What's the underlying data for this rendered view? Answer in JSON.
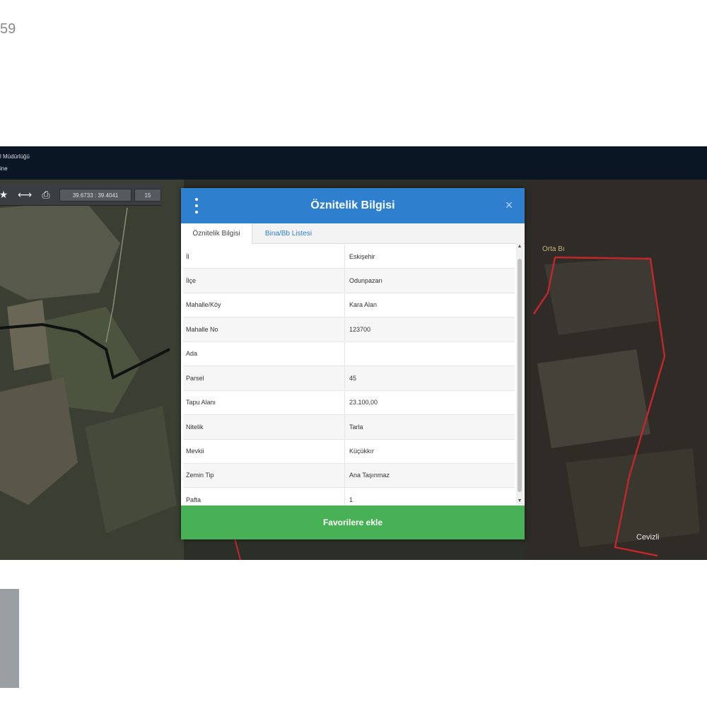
{
  "corner_text": "59",
  "header": {
    "org_text": "l Müdürlüğü",
    "sub_text": "ine"
  },
  "toolbar": {
    "star_icon": "star-icon",
    "measure_icon": "ruler-icon",
    "print_icon": "print-icon",
    "coordinates": "39.6733 : 39.4041",
    "zoom_level": "15"
  },
  "map": {
    "label_top": "Orta Bı",
    "label_bottom": "Cevizli"
  },
  "dialog": {
    "title": "Öznitelik Bilgisi",
    "close_glyph": "×",
    "tabs": [
      {
        "label": "Öznitelik Bilgisi",
        "active": true
      },
      {
        "label": "Bina/Bb Listesi",
        "active": false
      }
    ],
    "rows": [
      {
        "label": "İl",
        "value": "Eskişehir"
      },
      {
        "label": "İlçe",
        "value": "Odunpazarı"
      },
      {
        "label": "Mahalle/Köy",
        "value": "Kara Alan"
      },
      {
        "label": "Mahalle No",
        "value": "123700"
      },
      {
        "label": "Ada",
        "value": ""
      },
      {
        "label": "Parsel",
        "value": "45"
      },
      {
        "label": "Tapu Alanı",
        "value": "23.100,00"
      },
      {
        "label": "Nitelik",
        "value": "Tarla"
      },
      {
        "label": "Mevkii",
        "value": "Küçükkır"
      },
      {
        "label": "Zemin Tip",
        "value": "Ana Taşınmaz"
      },
      {
        "label": "Pafta",
        "value": "1"
      }
    ],
    "favorite_button": "Favorilere ekle"
  },
  "colors": {
    "header_blue": "#2f7fcf",
    "button_green": "#49b155",
    "parcel_border": "#c0262b"
  }
}
